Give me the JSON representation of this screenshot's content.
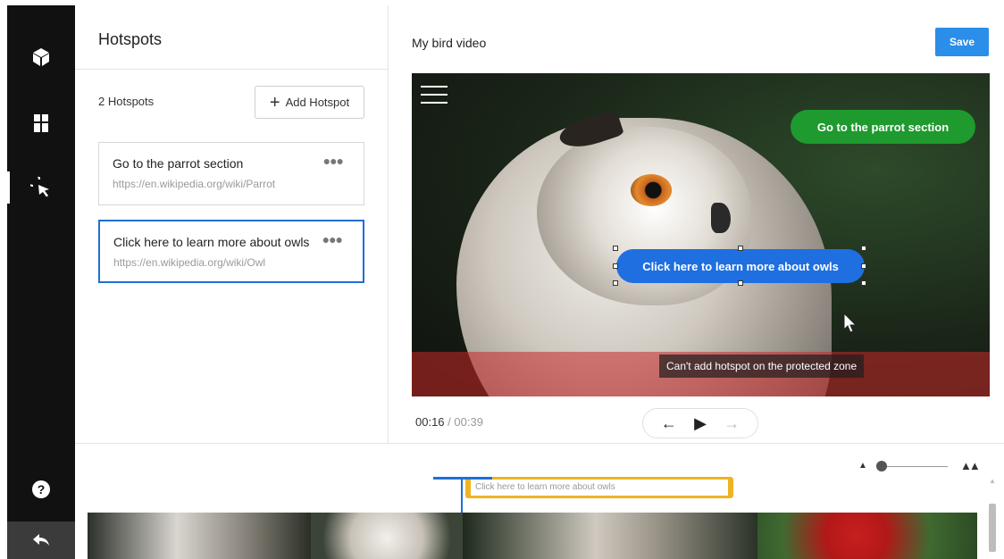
{
  "sidebar": {
    "icons": [
      "cube-icon",
      "film-icon",
      "cursor-select-icon",
      "help-icon",
      "back-icon"
    ]
  },
  "hotspots_panel": {
    "title": "Hotspots",
    "count_label": "2 Hotspots",
    "add_button_label": "Add Hotspot",
    "items": [
      {
        "title": "Go to the parrot section",
        "url": "https://en.wikipedia.org/wiki/Parrot",
        "selected": false
      },
      {
        "title": "Click here to learn more about owls",
        "url": "https://en.wikipedia.org/wiki/Owl",
        "selected": true
      }
    ]
  },
  "editor": {
    "video_title": "My bird video",
    "save_label": "Save",
    "hotspot_green_label": "Go to the parrot section",
    "hotspot_blue_label": "Click here to learn more about owls",
    "protected_zone_label": "Can't add hotspot on the protected zone",
    "current_time": "00:16",
    "separator": "/",
    "total_time": "00:39"
  },
  "timeline": {
    "track_label": "Click here to learn more about owls"
  },
  "colors": {
    "accent_blue": "#1f6fd8",
    "save_blue": "#2b8ee8",
    "hotspot_green": "#1e9a2e",
    "track_orange": "#f0b323",
    "protected_red": "#c82828"
  }
}
